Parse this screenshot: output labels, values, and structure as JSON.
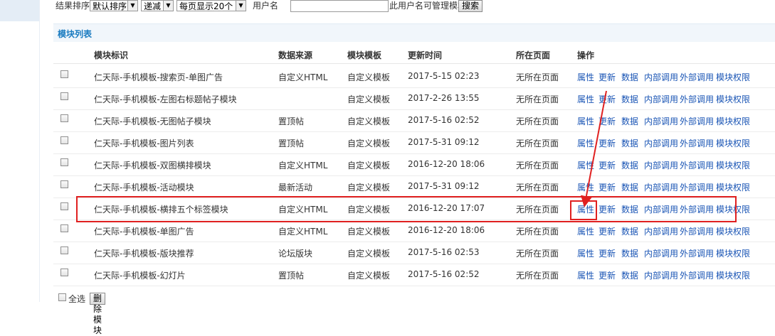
{
  "filter": {
    "sort_label": "结果排序",
    "sort_select": "默认排序",
    "order_select": "递减",
    "perpage_select": "每页显示20个",
    "username_label": "用户名",
    "username_value": "",
    "hint": "此用户名可管理模块",
    "search_button": "搜索"
  },
  "panel": {
    "title": "模块列表"
  },
  "columns": [
    "模块标识",
    "数据来源",
    "模块模板",
    "更新时间",
    "所在页面",
    "操作"
  ],
  "actions": [
    "属性",
    "更新",
    "数据",
    "内部调用",
    "外部调用",
    "模块权限"
  ],
  "rows": [
    {
      "name": "仁天际-手机模板-搜索页-单图广告",
      "source": "自定义HTML",
      "template": "自定义模板",
      "time": "2017-5-15 02:23",
      "page": "无所在页面"
    },
    {
      "name": "仁天际-手机模板-左图右标题帖子模块",
      "source": "",
      "template": "自定义模板",
      "time": "2017-2-26 13:55",
      "page": "无所在页面"
    },
    {
      "name": "仁天际-手机模板-无图帖子模块",
      "source": "置顶帖",
      "template": "自定义模板",
      "time": "2017-5-16 02:52",
      "page": "无所在页面"
    },
    {
      "name": "仁天际-手机模板-图片列表",
      "source": "置顶帖",
      "template": "自定义模板",
      "time": "2017-5-31 09:12",
      "page": "无所在页面"
    },
    {
      "name": "仁天际-手机模板-双图横排模块",
      "source": "自定义HTML",
      "template": "自定义模板",
      "time": "2016-12-20 18:06",
      "page": "无所在页面"
    },
    {
      "name": "仁天际-手机模板-活动模块",
      "source": "最新活动",
      "template": "自定义模板",
      "time": "2017-5-31 09:12",
      "page": "无所在页面"
    },
    {
      "name": "仁天际-手机模板-横排五个标签模块",
      "source": "自定义HTML",
      "template": "自定义模板",
      "time": "2016-12-20 17:07",
      "page": "无所在页面"
    },
    {
      "name": "仁天际-手机模板-单图广告",
      "source": "自定义HTML",
      "template": "自定义模板",
      "time": "2016-12-20 18:06",
      "page": "无所在页面"
    },
    {
      "name": "仁天际-手机模板-版块推荐",
      "source": "论坛版块",
      "template": "自定义模板",
      "time": "2017-5-16 02:53",
      "page": "无所在页面"
    },
    {
      "name": "仁天际-手机模板-幻灯片",
      "source": "置顶帖",
      "template": "自定义模板",
      "time": "2017-5-16 02:52",
      "page": "无所在页面"
    }
  ],
  "footer": {
    "select_all": "全选",
    "delete_button": "删除模块"
  },
  "colors": {
    "link": "#1a55b5",
    "panel_title": "#1a7bc0",
    "annotation": "#e02020"
  }
}
